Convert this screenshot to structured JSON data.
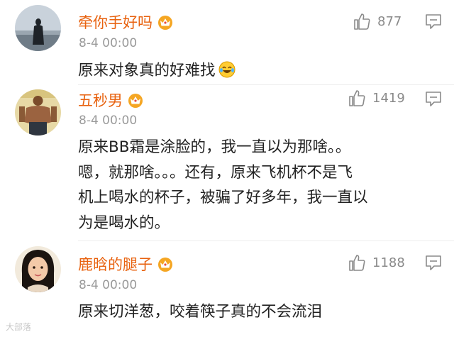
{
  "comments": [
    {
      "username": "牵你手好吗",
      "time": "8-4 00:00",
      "likes": "877",
      "lines": [
        "原来对象真的好难找"
      ],
      "emoji": "laughing-crying-emoji"
    },
    {
      "username": "五秒男",
      "time": "8-4 00:00",
      "likes": "1419",
      "lines": [
        "原来BB霜是涂脸的，我一直以为那啥。。",
        "嗯，就那啥。。。还有，原来飞机杯不是飞",
        "机上喝水的杯子，被骗了好多年，我一直以",
        "为是喝水的。"
      ]
    },
    {
      "username": "鹿晗的腿子",
      "time": "8-4 00:00",
      "likes": "1188",
      "lines": [
        "原来切洋葱，咬着筷子真的不会流泪"
      ]
    }
  ],
  "watermark": "大部落",
  "colors": {
    "username": "#e8620f",
    "time": "#9a9a9a",
    "text": "#222222",
    "icon": "#8a8a8a",
    "vip": "#f5a623"
  }
}
